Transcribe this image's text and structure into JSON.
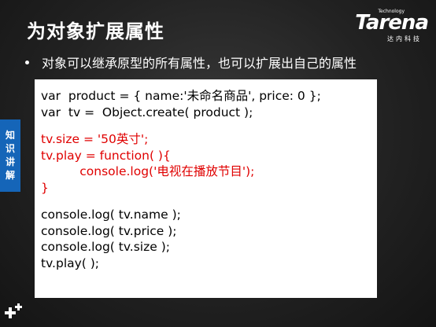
{
  "slide": {
    "title": "为对象扩展属性",
    "bullet": "对象可以继承原型的所有属性，也可以扩展出自己的属性"
  },
  "logo": {
    "word": "Tarena",
    "tagline": "Technology",
    "cn": "达内科技"
  },
  "side_tab": {
    "chars": [
      "知",
      "识",
      "讲",
      "解"
    ]
  },
  "code": {
    "line1": "var  product = { name:'未命名商品', price: 0 };",
    "line2": "var  tv =  Object.create( product );",
    "line3": "tv.size = '50英寸';",
    "line4": "tv.play = function( ){",
    "line5": "          console.log('电视在播放节目');",
    "line6": "}",
    "line7": "console.log( tv.name );",
    "line8": "console.log( tv.price );",
    "line9": "console.log( tv.size );",
    "line10": "tv.play( );"
  },
  "colors": {
    "background": "#222222",
    "code_text": "#000000",
    "code_highlight": "#e00000",
    "side_tab": "#1565b8",
    "title_text": "#ffffff"
  },
  "icons": {
    "corner": "plus-icon"
  }
}
